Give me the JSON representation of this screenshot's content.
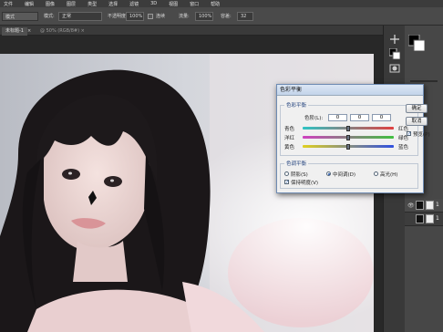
{
  "menubar": {
    "items": [
      "文件",
      "编辑",
      "图像",
      "图层",
      "类型",
      "选择",
      "滤镜",
      "3D",
      "视图",
      "窗口",
      "帮助"
    ]
  },
  "options": {
    "tool": "模式",
    "mode_label": "模式:",
    "mode_value": "正常",
    "opacity_label": "不透明度:",
    "opacity_value": "100%",
    "flow_label": "流量:",
    "flow_value": "100%",
    "check_label": "连续",
    "size_label": "容差:",
    "size_value": "32"
  },
  "document": {
    "tab_label": "未标题-1",
    "tab_close": "×",
    "second_tab": "@ 50% (RGB/8#) ×"
  },
  "dialog": {
    "title": "色彩平衡",
    "group_color_balance": "色彩平衡",
    "levels_label": "色阶(L):",
    "levels": [
      "0",
      "0",
      "0"
    ],
    "sliders": [
      {
        "left": "青色",
        "right": "红色",
        "value": 0
      },
      {
        "left": "洋红",
        "right": "绿色",
        "value": 0
      },
      {
        "left": "黄色",
        "right": "蓝色",
        "value": 0
      }
    ],
    "group_tone_balance": "色调平衡",
    "tone_options": [
      "阴影(S)",
      "中间调(D)",
      "高光(H)"
    ],
    "tone_selected": 1,
    "preserve_luminosity": "保持明度(V)",
    "preserve_checked": true,
    "buttons": [
      "确定",
      "取消"
    ],
    "preview_label": "预览(P)",
    "preview_checked": true
  },
  "layers": {
    "rows": [
      {
        "eye": "👁",
        "name": "1"
      },
      {
        "eye": "",
        "name": "1"
      }
    ]
  },
  "colors": {
    "accent": "#1c3d7a",
    "cyan_red": [
      "#2ec4c4",
      "#e04040"
    ],
    "magenta_green": [
      "#d040c0",
      "#40c040"
    ],
    "yellow_blue": [
      "#e0d020",
      "#3050e0"
    ]
  }
}
